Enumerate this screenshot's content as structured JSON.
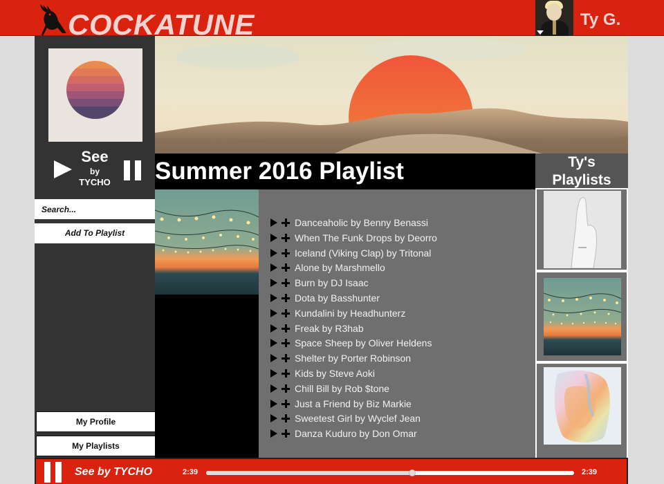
{
  "header": {
    "brand": "COCKATUNE",
    "username": "Ty G.",
    "logo_icon": "cockatoo-icon",
    "accent": "#d9230f"
  },
  "sidebar": {
    "now_playing": {
      "title": "See",
      "by": "by",
      "artist": "TYCHO"
    },
    "search_placeholder": "Search...",
    "add_to_playlist": "Add To Playlist",
    "nav": {
      "profile": "My Profile",
      "playlists": "My Playlists"
    }
  },
  "playlist": {
    "title": "Summer 2016 Playlist",
    "tracks": [
      "Danceaholic by Benny Benassi",
      "When The Funk Drops by Deorro",
      "Iceland (Viking Clap) by Tritonal",
      "Alone by Marshmello",
      "Burn by DJ Isaac",
      "Dota by Basshunter",
      "Kundalini by Headhunterz",
      "Freak by R3hab",
      "Space Sheep by Oliver Heldens",
      "Shelter by Porter Robinson",
      "Kids by Steve Aoki",
      "Chill Bill by Rob $tone",
      "Just a Friend by Biz Markie",
      "Sweetest Girl by Wyclef Jean",
      "Danza Kuduro by Don Omar"
    ]
  },
  "right_panel": {
    "title_line1": "Ty's",
    "title_line2": "Playlists"
  },
  "player": {
    "now_playing": "See by TYCHO",
    "current_time": "2:39",
    "total_time": "2:39",
    "progress": 0.56
  }
}
